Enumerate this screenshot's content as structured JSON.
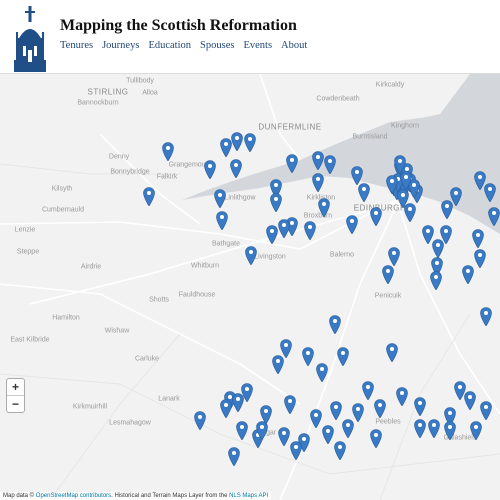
{
  "site_title": "Mapping the Scottish Reformation",
  "nav": [
    "Tenures",
    "Journeys",
    "Education",
    "Spouses",
    "Events",
    "About"
  ],
  "map": {
    "place_labels": [
      "Tullibody",
      "Alloa",
      "STIRLING",
      "Bannockburn",
      "DUNFERMLINE",
      "Kirkcaldy",
      "Cowdenbeath",
      "Kinghorn",
      "Burntisland",
      "Denny",
      "Bonnybridge",
      "Falkirk",
      "Grangemouth",
      "Kilsyth",
      "Cumbernauld",
      "Linlithgow",
      "Kirkliston",
      "Broxburn",
      "Bathgate",
      "Livingston",
      "Balerno",
      "EDINBURGH",
      "Penicuik",
      "Lenzie",
      "Steppe",
      "Airdrie",
      "Whitburn",
      "Fauldhouse",
      "Shotts",
      "Hamilton",
      "Wishaw",
      "Carluke",
      "East Kilbride",
      "Lanark",
      "Kirkmuirhill",
      "Lesmahagow",
      "Biggar",
      "Peebles",
      "Galashiels"
    ],
    "marker_icon": "map-pin-icon",
    "marker_color": "#3a79c4",
    "water_color": "#d3d7dc",
    "land_color": "#f2f2f2",
    "marker_count": 96
  },
  "zoom": {
    "in": "+",
    "out": "−"
  },
  "attribution": {
    "prefix": "Map data © ",
    "osm": "OpenStreetMap contributors",
    "middle": ". Historical and Terrain Maps Layer from the ",
    "nls": "NLS Maps API"
  }
}
